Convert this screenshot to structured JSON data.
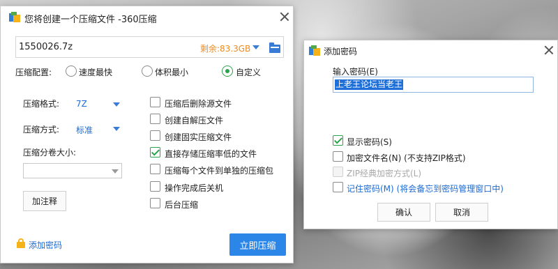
{
  "main_dialog": {
    "title": "您将创建一个压缩文件 -360压缩",
    "path_value": "1550026.7z",
    "free_space": "剩余:83.3GB",
    "config_label": "压缩配置:",
    "config_options": [
      "速度最快",
      "体积最小",
      "自定义"
    ],
    "config_selected": "自定义",
    "format_label": "压缩格式:",
    "format_value": "7Z",
    "method_label": "压缩方式:",
    "method_value": "标准",
    "split_label": "压缩分卷大小:",
    "split_value": "",
    "comment_button": "加注释",
    "options": [
      {
        "label": "压缩后删除源文件",
        "checked": false
      },
      {
        "label": "创建自解压文件",
        "checked": false
      },
      {
        "label": "创建固实压缩文件",
        "checked": false
      },
      {
        "label": "直接存储压缩率低的文件",
        "checked": true
      },
      {
        "label": "压缩每个文件到单独的压缩包",
        "checked": false
      },
      {
        "label": "操作完成后关机",
        "checked": false
      },
      {
        "label": "后台压缩",
        "checked": false
      }
    ],
    "add_password_link": "添加密码",
    "compress_button": "立即压缩",
    "colors": {
      "accent": "#2b86e8",
      "free_space": "#f08a1c",
      "check": "#2aa24a"
    }
  },
  "password_dialog": {
    "title": "添加密码",
    "input_label": "输入密码(E)",
    "input_value": "上老王论坛当老王",
    "options": [
      {
        "label": "显示密码(S)",
        "checked": true,
        "disabled": false
      },
      {
        "label": "加密文件名(N) (不支持ZIP格式)",
        "checked": false,
        "disabled": false
      },
      {
        "label": "ZIP经典加密方式(L)",
        "checked": false,
        "disabled": true
      },
      {
        "label": "记住密码(M) (将会备忘到密码管理窗口中)",
        "checked": false,
        "disabled": false
      }
    ],
    "ok_button": "确认",
    "cancel_button": "取消"
  }
}
